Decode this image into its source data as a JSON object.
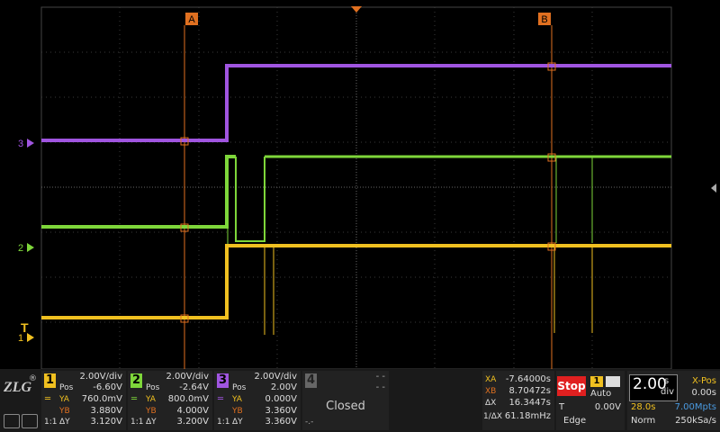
{
  "markers": {
    "a": "A",
    "b": "B",
    "ch3": "3",
    "ch2": "2",
    "ch1": "1",
    "trigger": "T"
  },
  "channels": [
    {
      "num": "1",
      "color": "#f0c020",
      "vdiv": "2.00V/div",
      "pos_label": "Pos",
      "pos": "-6.60V",
      "ya_label": "YA",
      "ya": "760.0mV",
      "yb_label": "YB",
      "yb": "3.880V",
      "dy_label": "ΔY",
      "dy": "3.120V",
      "coupling": "1:1"
    },
    {
      "num": "2",
      "color": "#7ed63a",
      "vdiv": "2.00V/div",
      "pos_label": "Pos",
      "pos": "-2.64V",
      "ya_label": "YA",
      "ya": "800.0mV",
      "yb_label": "YB",
      "yb": "4.000V",
      "dy_label": "ΔY",
      "dy": "3.200V",
      "coupling": "1:1"
    },
    {
      "num": "3",
      "color": "#a055e0",
      "vdiv": "2.00V/div",
      "pos_label": "Pos",
      "pos": "2.00V",
      "ya_label": "YA",
      "ya": "0.000V",
      "yb_label": "YB",
      "yb": "3.360V",
      "dy_label": "ΔY",
      "dy": "3.360V",
      "coupling": "1:1"
    },
    {
      "num": "4",
      "dashes": "- -",
      "status": "Closed",
      "dots": "-.-"
    }
  ],
  "cursors": {
    "xa_label": "XA",
    "xa": "-7.64000s",
    "xb_label": "XB",
    "xb": "8.70472s",
    "dx_label": "ΔX",
    "dx": "16.3447s",
    "inv_label": "1/ΔX",
    "inv": "61.18mHz"
  },
  "run": {
    "state": "Stop",
    "trig_ch": "1",
    "mode": "Auto",
    "t_label": "T",
    "level": "0.00V",
    "type": "Edge"
  },
  "timebase": {
    "value": "2.00",
    "unit_top": "s",
    "unit_bottom": "div",
    "xpos_label": "X-Pos",
    "xpos": "0.00s",
    "window": "28.0s",
    "depth": "7.00Mpts",
    "acq": "Norm",
    "rate": "250kSa/s"
  },
  "brand": {
    "logo": "ZLG",
    "reg": "®"
  },
  "colors": {
    "ch1": "#f0c020",
    "ch2": "#7ed63a",
    "ch3": "#a055e0",
    "cursor": "#e07020",
    "stop": "#e02020"
  }
}
